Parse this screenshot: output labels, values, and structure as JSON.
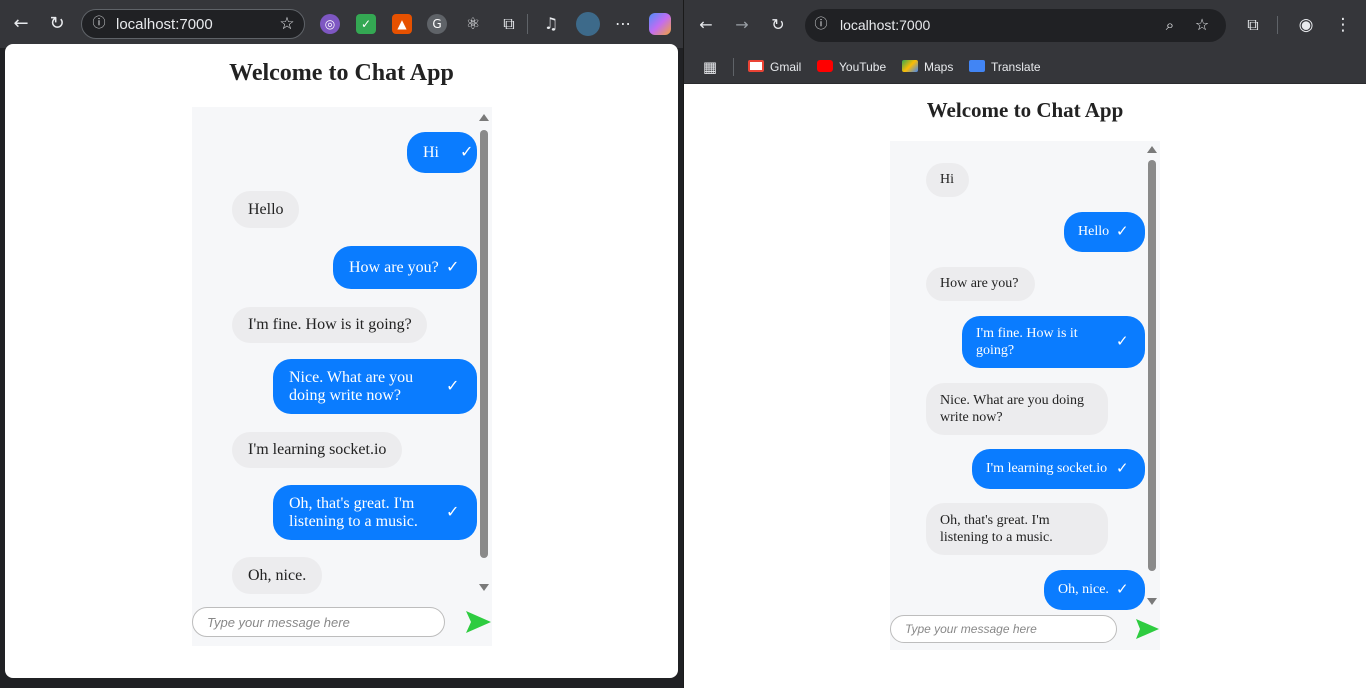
{
  "left_browser": {
    "url": "localhost:7000",
    "page_title": "Welcome to Chat App",
    "input_placeholder": "Type your message here",
    "messages": [
      {
        "dir": "out",
        "text": "Hi",
        "tick": "✓"
      },
      {
        "dir": "in",
        "text": "Hello"
      },
      {
        "dir": "out",
        "text": "How are you?",
        "tick": "✓"
      },
      {
        "dir": "in",
        "text": "I'm fine. How is it going?"
      },
      {
        "dir": "out",
        "text": "Nice. What are you doing write now?",
        "tick": "✓"
      },
      {
        "dir": "in",
        "text": "I'm learning socket.io"
      },
      {
        "dir": "out",
        "text": "Oh, that's great. I'm listening to a music.",
        "tick": "✓"
      },
      {
        "dir": "in",
        "text": "Oh, nice."
      }
    ]
  },
  "right_browser": {
    "url": "localhost:7000",
    "bookmarks": [
      "Gmail",
      "YouTube",
      "Maps",
      "Translate"
    ],
    "page_title": "Welcome to Chat App",
    "input_placeholder": "Type your message here",
    "messages": [
      {
        "dir": "in",
        "text": "Hi"
      },
      {
        "dir": "out",
        "text": "Hello",
        "tick": "✓"
      },
      {
        "dir": "in",
        "text": "How are you?"
      },
      {
        "dir": "out",
        "text": "I'm fine. How is it going?",
        "tick": "✓"
      },
      {
        "dir": "in",
        "text": "Nice. What are you doing write now?"
      },
      {
        "dir": "out",
        "text": "I'm learning socket.io",
        "tick": "✓"
      },
      {
        "dir": "in",
        "text": "Oh, that's great. I'm listening to a music."
      },
      {
        "dir": "out",
        "text": "Oh, nice.",
        "tick": "✓"
      }
    ]
  },
  "colors": {
    "sent_bubble": "#0a7cff",
    "received_bubble": "#ececee",
    "send_button": "#2ecc40",
    "chrome_toolbar": "#35363a"
  },
  "icons": {
    "back": "back-arrow-icon",
    "forward": "forward-arrow-icon",
    "reload": "reload-icon",
    "site_info": "info-icon",
    "bookmark_star": "star-icon",
    "zoom": "zoom-icon",
    "extensions": "puzzle-icon",
    "profile": "profile-icon",
    "menu": "kebab-menu-icon",
    "apps": "apps-grid-icon",
    "send": "send-arrow-icon"
  }
}
